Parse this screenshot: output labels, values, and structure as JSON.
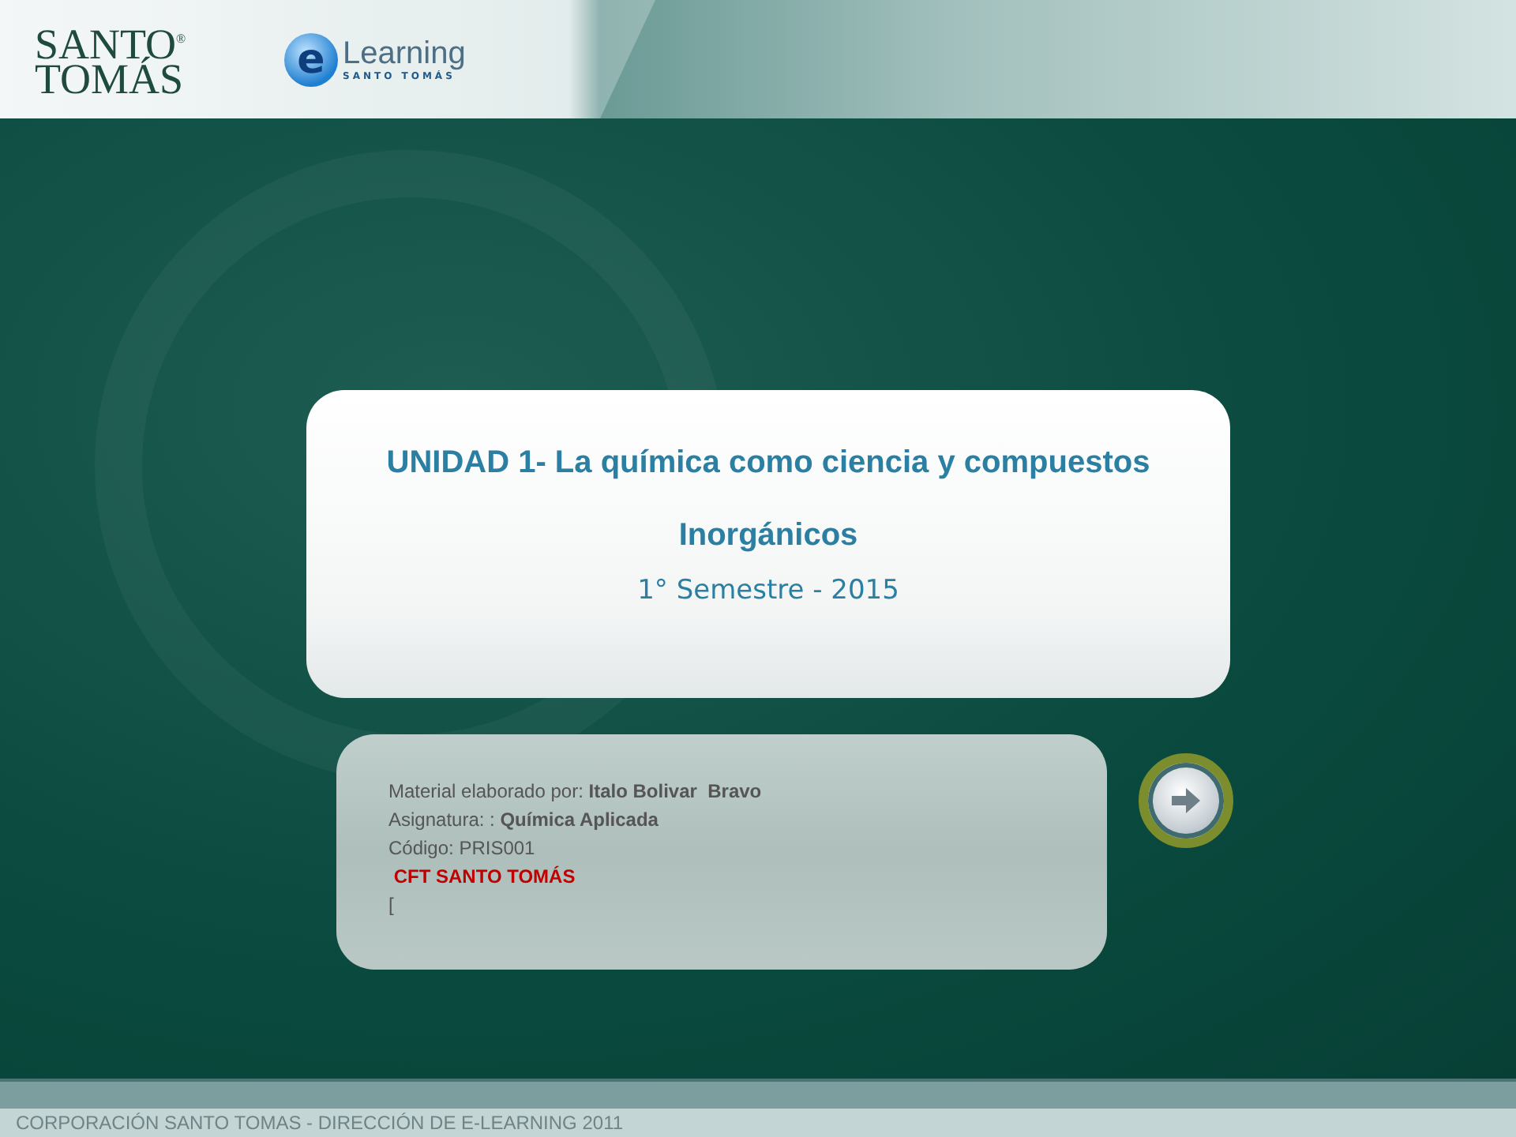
{
  "header": {
    "logo": {
      "line_1": "SANTO",
      "mark": "®",
      "line_2": "TOMÁS"
    },
    "elearning_logo": {
      "letter": "e",
      "word": "Learning",
      "subtitle": "SANTO TOMÁS"
    }
  },
  "title_card": {
    "title": "UNIDAD 1- La química como ciencia y compuestos Inorgánicos",
    "subtitle": "1° Semestre  - 2015"
  },
  "info_card": {
    "lines": [
      {
        "kind": "plain",
        "text": "Material elaborado por: **Italo Bolivar  Bravo**"
      },
      {
        "kind": "plain",
        "text": "Asignatura: : **Química Aplicada**"
      },
      {
        "kind": "plain",
        "text": "Código: PRIS001"
      },
      {
        "kind": "highlight",
        "text": " CFT SANTO TOMÁS"
      },
      {
        "kind": "plain",
        "text": "["
      }
    ]
  },
  "footer": {
    "text": "CORPORACIÓN SANTO TOMAS - DIRECCIÓN DE E-LEARNING  2011"
  }
}
